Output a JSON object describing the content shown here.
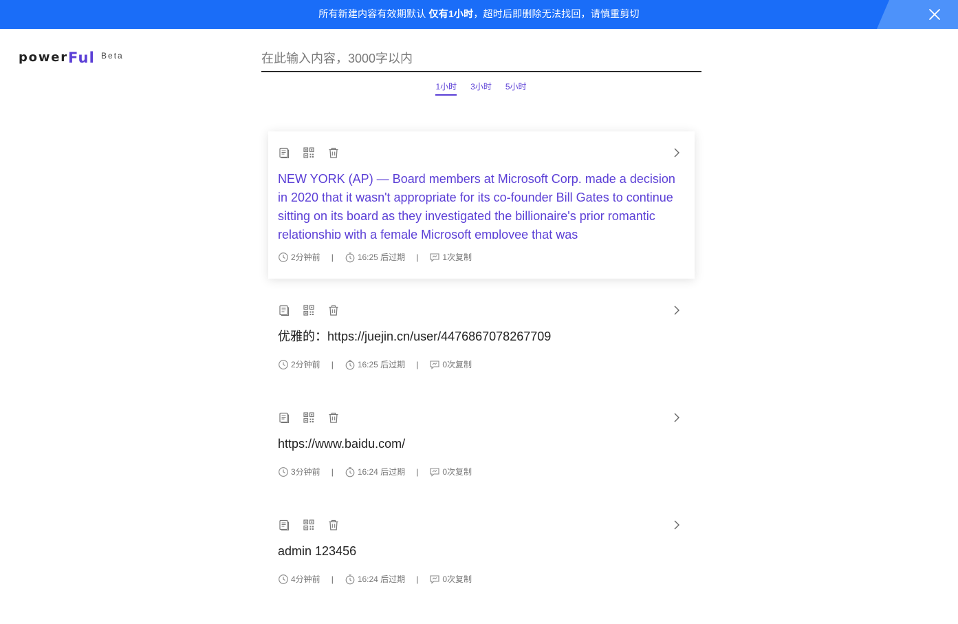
{
  "banner": {
    "text_prefix": "所有新建内容有效期默认 ",
    "text_bold": "仅有1小时",
    "text_suffix": "，超时后即删除无法找回，请慎重剪切"
  },
  "logo": {
    "main": "power",
    "accent": "Ful",
    "badge": "Beta"
  },
  "input": {
    "placeholder": "在此输入内容，3000字以内",
    "value": ""
  },
  "durations": [
    {
      "label": "1小时",
      "active": true
    },
    {
      "label": "3小时",
      "active": false
    },
    {
      "label": "5小时",
      "active": false
    }
  ],
  "colors": {
    "banner": "#1a6df8",
    "accent": "#5b3fd6"
  },
  "items": [
    {
      "content": "NEW YORK (AP) — Board members at Microsoft Corp. made a decision in 2020 that it wasn't appropriate for its co-founder Bill Gates to continue sitting on its board as they investigated the billionaire's prior romantic relationship with a female Microsoft employee that was",
      "created": "2分钟前",
      "expires": "16:25 后过期",
      "copies": "1次复制",
      "active": true
    },
    {
      "content": "优雅的：https://juejin.cn/user/4476867078267709",
      "created": "2分钟前",
      "expires": "16:25 后过期",
      "copies": "0次复制",
      "active": false
    },
    {
      "content": "https://www.baidu.com/",
      "created": "3分钟前",
      "expires": "16:24 后过期",
      "copies": "0次复制",
      "active": false
    },
    {
      "content": "admin 123456",
      "created": "4分钟前",
      "expires": "16:24 后过期",
      "copies": "0次复制",
      "active": false
    }
  ]
}
